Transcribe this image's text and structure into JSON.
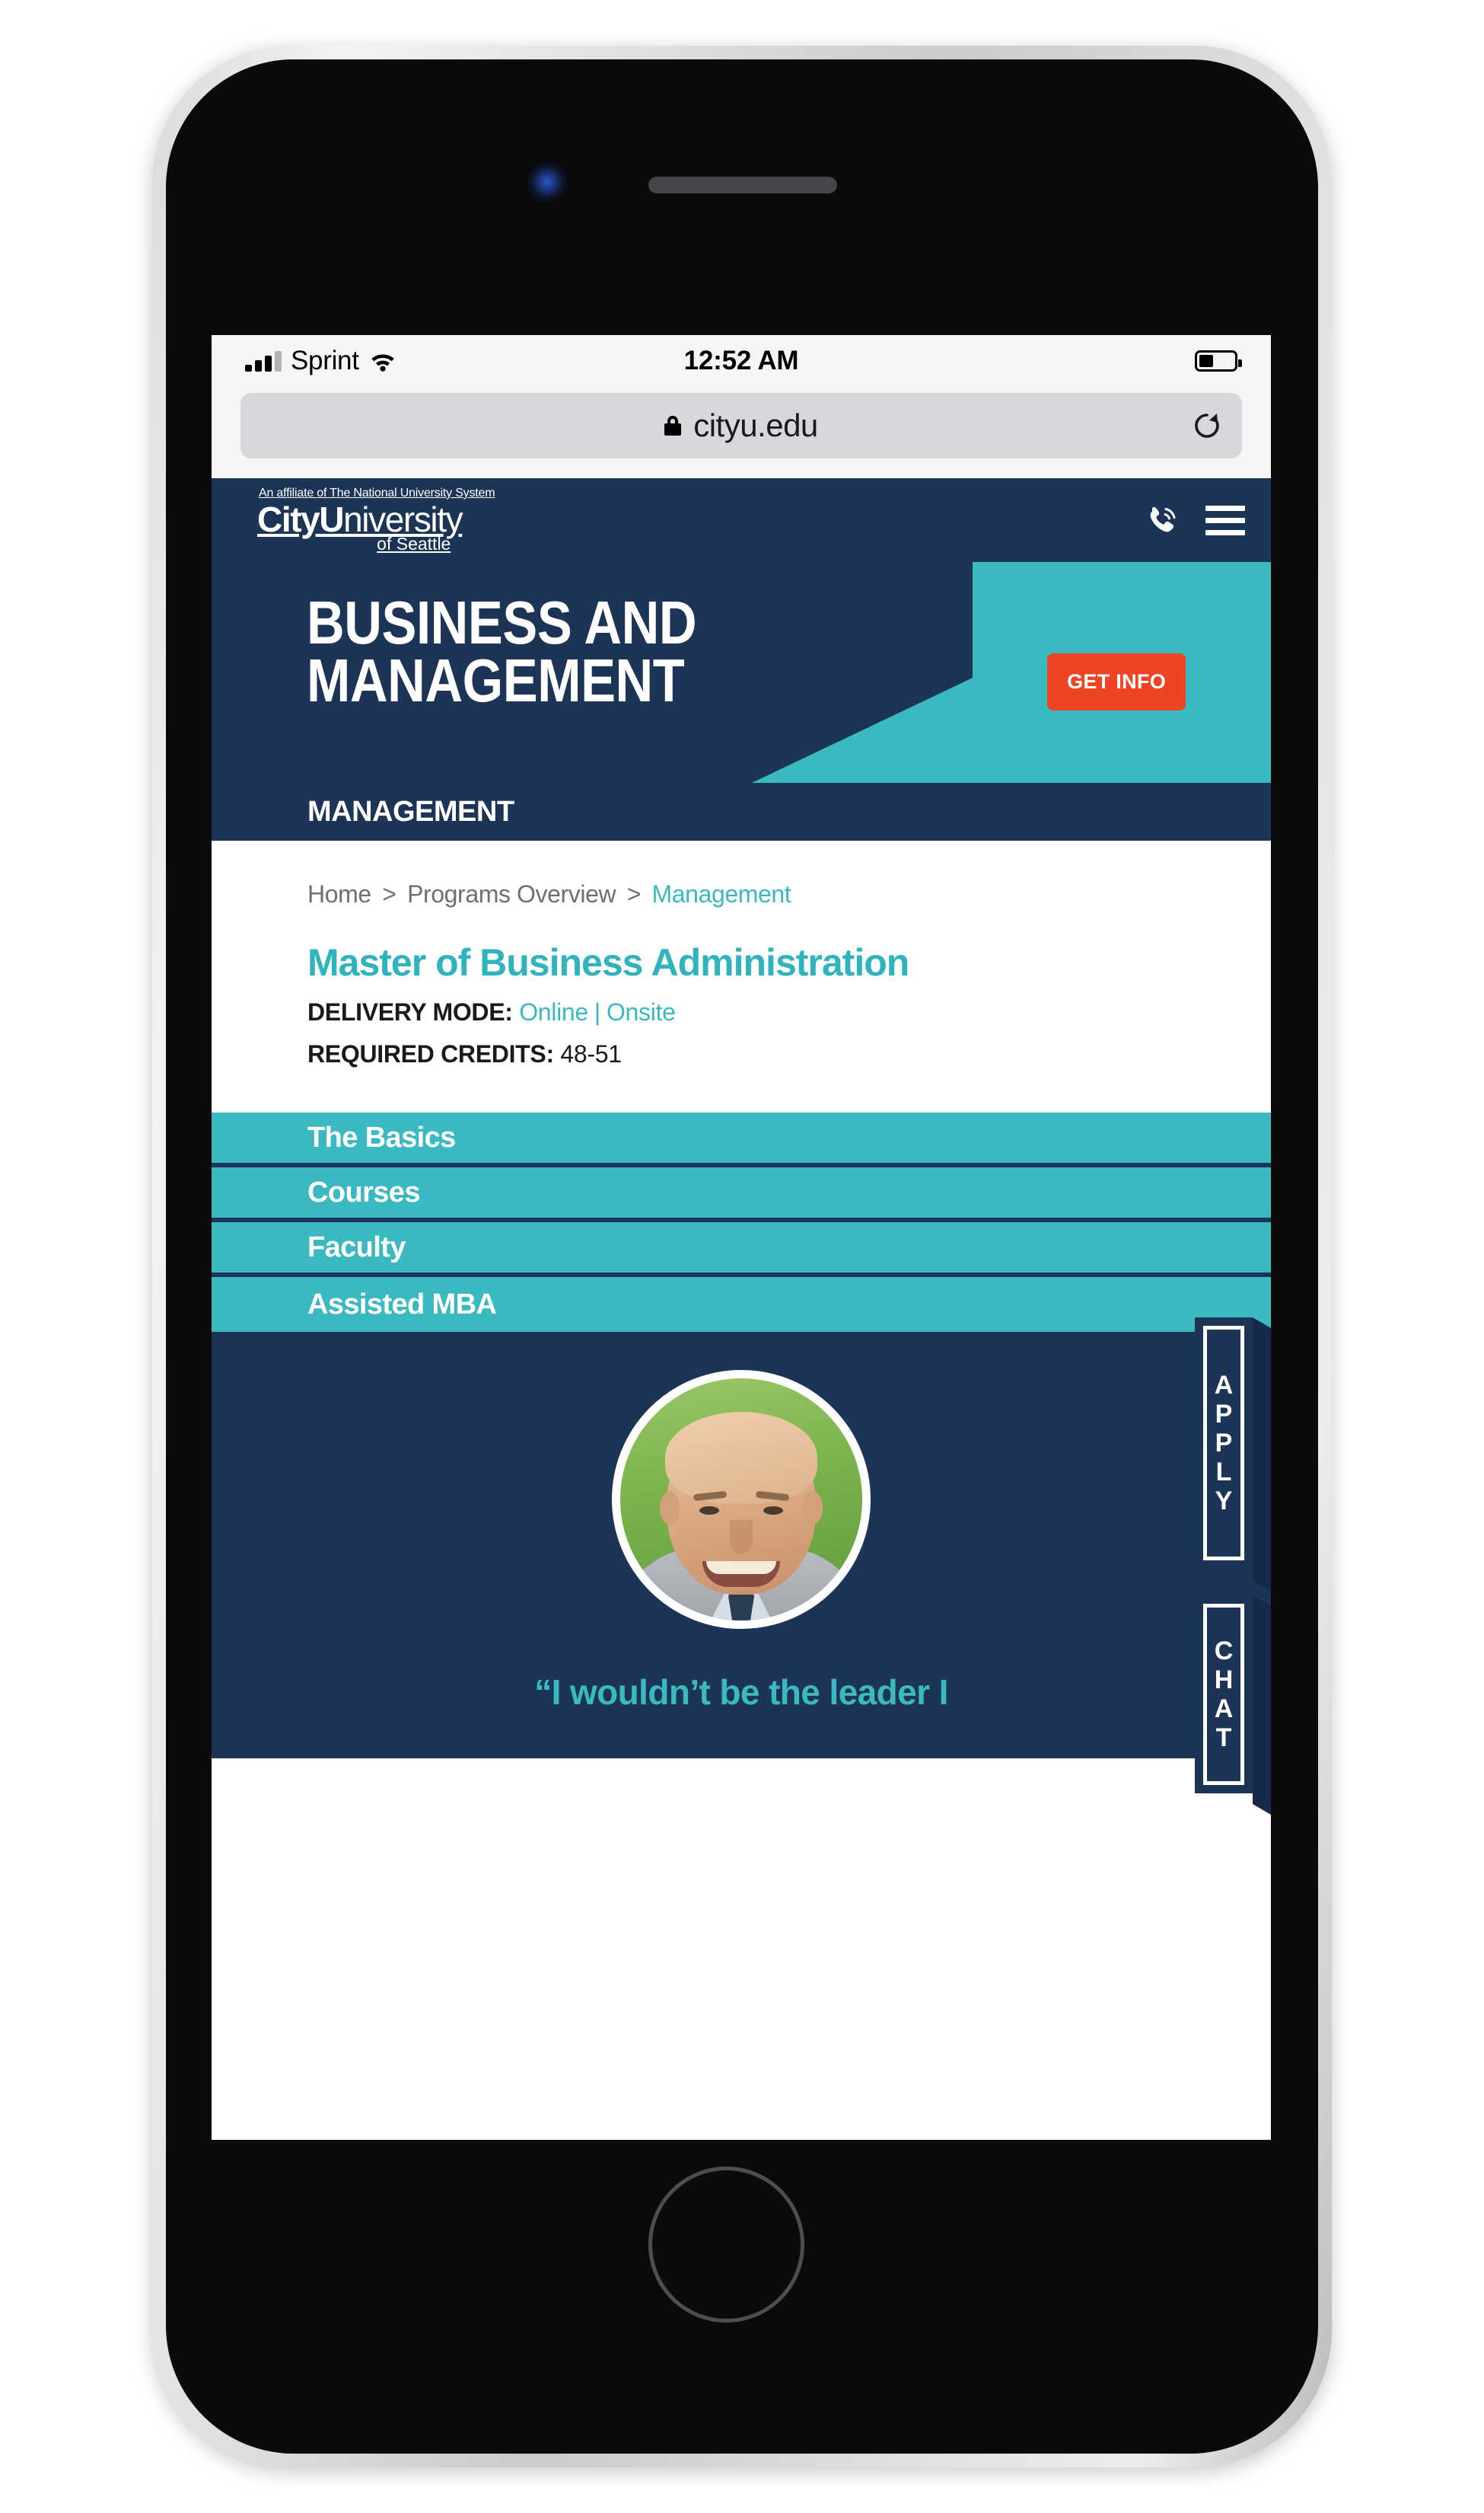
{
  "status_bar": {
    "carrier": "Sprint",
    "time": "12:52 AM",
    "wifi_icon": "wifi-icon",
    "signal_icon": "cellular-signal-icon",
    "battery_icon": "battery-icon"
  },
  "browser": {
    "url": "cityu.edu",
    "lock_icon": "lock-icon",
    "reload_icon": "reload-icon"
  },
  "site_header": {
    "affiliate_line": "An affiliate of The National University System",
    "logo_bold": "CityU",
    "logo_rest": "niversity",
    "logo_sub": "of Seattle",
    "phone_icon": "phone-icon",
    "menu_icon": "hamburger-menu-icon"
  },
  "hero": {
    "title_line1": "BUSINESS AND",
    "title_line2": "MANAGEMENT",
    "cta_label": "GET INFO"
  },
  "section_strip": {
    "label": "MANAGEMENT"
  },
  "breadcrumb": {
    "items": [
      "Home",
      "Programs Overview",
      "Management"
    ],
    "separator": ">"
  },
  "program": {
    "title": "Master of Business Administration",
    "delivery_mode_label": "DELIVERY MODE:",
    "delivery_online": "Online",
    "delivery_separator": "|",
    "delivery_onsite": "Onsite",
    "credits_label": "REQUIRED CREDITS:",
    "credits_value": "48-51"
  },
  "accordion": {
    "items": [
      {
        "label": "The Basics"
      },
      {
        "label": "Courses"
      },
      {
        "label": "Faculty"
      },
      {
        "label": "Assisted MBA"
      }
    ]
  },
  "side_tabs": {
    "apply": {
      "label": "APPLY",
      "letters": [
        "A",
        "P",
        "P",
        "L",
        "Y"
      ]
    },
    "chat": {
      "label": "CHAT",
      "letters": [
        "C",
        "H",
        "A",
        "T"
      ]
    }
  },
  "testimonial": {
    "avatar_name": "student-portrait",
    "quote": "“I wouldn’t be the leader I"
  },
  "colors": {
    "navy": "#1c3557",
    "teal": "#3bb9c0",
    "orange": "#ee4423",
    "white": "#ffffff",
    "status_bg": "#f5f5f5",
    "url_field": "#d8d8dc"
  }
}
